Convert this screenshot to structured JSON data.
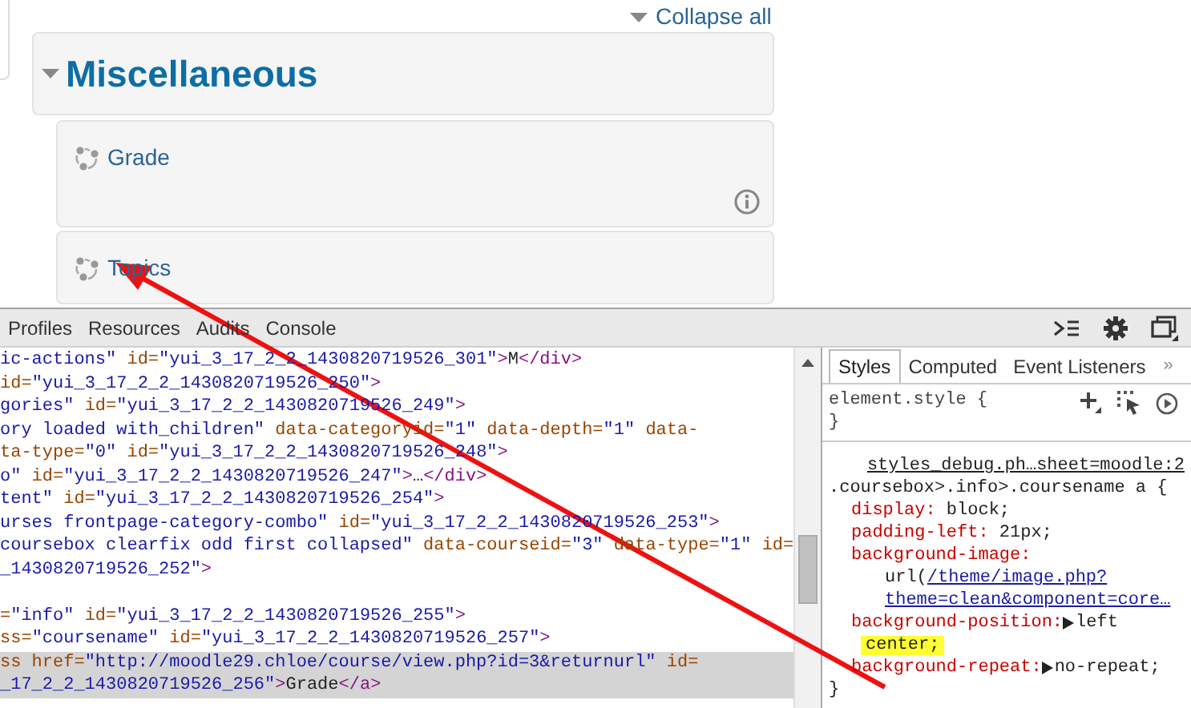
{
  "page": {
    "collapse_all": "Collapse all",
    "category": {
      "title": "Miscellaneous",
      "expanded": true,
      "courses": [
        {
          "name": "Grade",
          "has_info": true
        },
        {
          "name": "Topics",
          "has_info": false
        }
      ]
    }
  },
  "devtools": {
    "tabs": [
      {
        "label": "Profiles",
        "selected": false
      },
      {
        "label": "Resources",
        "selected": false
      },
      {
        "label": "Audits",
        "selected": false
      },
      {
        "label": "Console",
        "selected": false
      }
    ],
    "elements": {
      "lines": [
        {
          "kind": "code",
          "selected": false,
          "tokens": [
            {
              "kind": "val",
              "text": "ic-actions\""
            },
            {
              "kind": "attr",
              "text": " id="
            },
            {
              "kind": "val",
              "text": "\"yui_3_17_2_2_1430820719526_301\""
            },
            {
              "kind": "tag",
              "text": ">"
            },
            {
              "kind": "text",
              "text": "M"
            },
            {
              "kind": "tag",
              "text": "</div>"
            }
          ]
        },
        {
          "kind": "code",
          "selected": false,
          "tokens": [
            {
              "kind": "attr",
              "text": "id="
            },
            {
              "kind": "val",
              "text": "\"yui_3_17_2_2_1430820719526_250\""
            },
            {
              "kind": "tag",
              "text": ">"
            }
          ]
        },
        {
          "kind": "code",
          "selected": false,
          "tokens": [
            {
              "kind": "val",
              "text": "gories\""
            },
            {
              "kind": "attr",
              "text": " id="
            },
            {
              "kind": "val",
              "text": "\"yui_3_17_2_2_1430820719526_249\""
            },
            {
              "kind": "tag",
              "text": ">"
            }
          ]
        },
        {
          "kind": "code",
          "selected": false,
          "tokens": [
            {
              "kind": "val",
              "text": "ory loaded with_children\""
            },
            {
              "kind": "attr",
              "text": " data-categoryid="
            },
            {
              "kind": "val",
              "text": "\"1\""
            },
            {
              "kind": "attr",
              "text": " data-depth="
            },
            {
              "kind": "val",
              "text": "\"1\""
            },
            {
              "kind": "attr",
              "text": " data-"
            }
          ]
        },
        {
          "kind": "code",
          "selected": false,
          "tokens": [
            {
              "kind": "attr",
              "text": "ta-type="
            },
            {
              "kind": "val",
              "text": "\"0\""
            },
            {
              "kind": "attr",
              "text": " id="
            },
            {
              "kind": "val",
              "text": "\"yui_3_17_2_2_1430820719526_248\""
            },
            {
              "kind": "tag",
              "text": ">"
            }
          ]
        },
        {
          "kind": "code",
          "selected": false,
          "tokens": [
            {
              "kind": "val",
              "text": "o\""
            },
            {
              "kind": "attr",
              "text": " id="
            },
            {
              "kind": "val",
              "text": "\"yui_3_17_2_2_1430820719526_247\""
            },
            {
              "kind": "tag",
              "text": ">"
            },
            {
              "kind": "text",
              "text": "…"
            },
            {
              "kind": "tag",
              "text": "</div>"
            }
          ]
        },
        {
          "kind": "code",
          "selected": false,
          "tokens": [
            {
              "kind": "val",
              "text": "tent\""
            },
            {
              "kind": "attr",
              "text": " id="
            },
            {
              "kind": "val",
              "text": "\"yui_3_17_2_2_1430820719526_254\""
            },
            {
              "kind": "tag",
              "text": ">"
            }
          ]
        },
        {
          "kind": "code",
          "selected": false,
          "tokens": [
            {
              "kind": "val",
              "text": "urses frontpage-category-combo\""
            },
            {
              "kind": "attr",
              "text": " id="
            },
            {
              "kind": "val",
              "text": "\"yui_3_17_2_2_1430820719526_253\""
            },
            {
              "kind": "tag",
              "text": ">"
            }
          ]
        },
        {
          "kind": "code",
          "selected": false,
          "tokens": [
            {
              "kind": "val",
              "text": "coursebox clearfix odd first collapsed\""
            },
            {
              "kind": "attr",
              "text": " data-courseid="
            },
            {
              "kind": "val",
              "text": "\"3\""
            },
            {
              "kind": "attr",
              "text": " data-type="
            },
            {
              "kind": "val",
              "text": "\"1\""
            },
            {
              "kind": "attr",
              "text": " id="
            }
          ]
        },
        {
          "kind": "code",
          "selected": false,
          "tokens": [
            {
              "kind": "val",
              "text": "_1430820719526_252\""
            },
            {
              "kind": "tag",
              "text": ">"
            }
          ]
        },
        {
          "kind": "blank"
        },
        {
          "kind": "code",
          "selected": false,
          "tokens": [
            {
              "kind": "attr",
              "text": "="
            },
            {
              "kind": "val",
              "text": "\"info\""
            },
            {
              "kind": "attr",
              "text": " id="
            },
            {
              "kind": "val",
              "text": "\"yui_3_17_2_2_1430820719526_255\""
            },
            {
              "kind": "tag",
              "text": ">"
            }
          ]
        },
        {
          "kind": "code",
          "selected": false,
          "tokens": [
            {
              "kind": "attr",
              "text": "ss="
            },
            {
              "kind": "val",
              "text": "\"coursename\""
            },
            {
              "kind": "attr",
              "text": " id="
            },
            {
              "kind": "val",
              "text": "\"yui_3_17_2_2_1430820719526_257\""
            },
            {
              "kind": "tag",
              "text": ">"
            }
          ]
        },
        {
          "kind": "code",
          "selected": true,
          "tokens": [
            {
              "kind": "attr",
              "text": "ss href="
            },
            {
              "kind": "val",
              "text": "\"http://moodle29.chloe/course/view.php?id=3&returnurl\""
            },
            {
              "kind": "attr",
              "text": " id="
            }
          ]
        },
        {
          "kind": "code",
          "selected": true,
          "tokens": [
            {
              "kind": "val",
              "text": "_17_2_2_1430820719526_256\""
            },
            {
              "kind": "tag",
              "text": ">"
            },
            {
              "kind": "text",
              "text": "Grade"
            },
            {
              "kind": "tag",
              "text": "</a>"
            }
          ]
        }
      ]
    },
    "sidebar": {
      "tabs": [
        {
          "label": "Styles",
          "selected": true
        },
        {
          "label": "Computed",
          "selected": false
        },
        {
          "label": "Event Listeners",
          "selected": false
        }
      ],
      "more": "»",
      "element_style": {
        "selector": "element.style {",
        "close": "}"
      },
      "rule": {
        "source": "styles_debug.ph…sheet=moodle:2",
        "selector": ".coursebox>.info>.coursename a {",
        "close": "}",
        "declarations": [
          {
            "kind": "simple",
            "property": "display:",
            "value": "block;"
          },
          {
            "kind": "simple",
            "property": "padding-left:",
            "value": "21px;"
          },
          {
            "kind": "url",
            "property": "background-image:",
            "prefix": "url(",
            "link_lines": [
              "/theme/image.php?",
              "theme=clean&component=core…"
            ]
          },
          {
            "kind": "expandable",
            "property": "background-position:",
            "value": "left",
            "continuation": "center;",
            "highlight": true
          },
          {
            "kind": "expandable",
            "property": "background-repeat:",
            "value": "no-repeat;"
          }
        ]
      }
    }
  }
}
